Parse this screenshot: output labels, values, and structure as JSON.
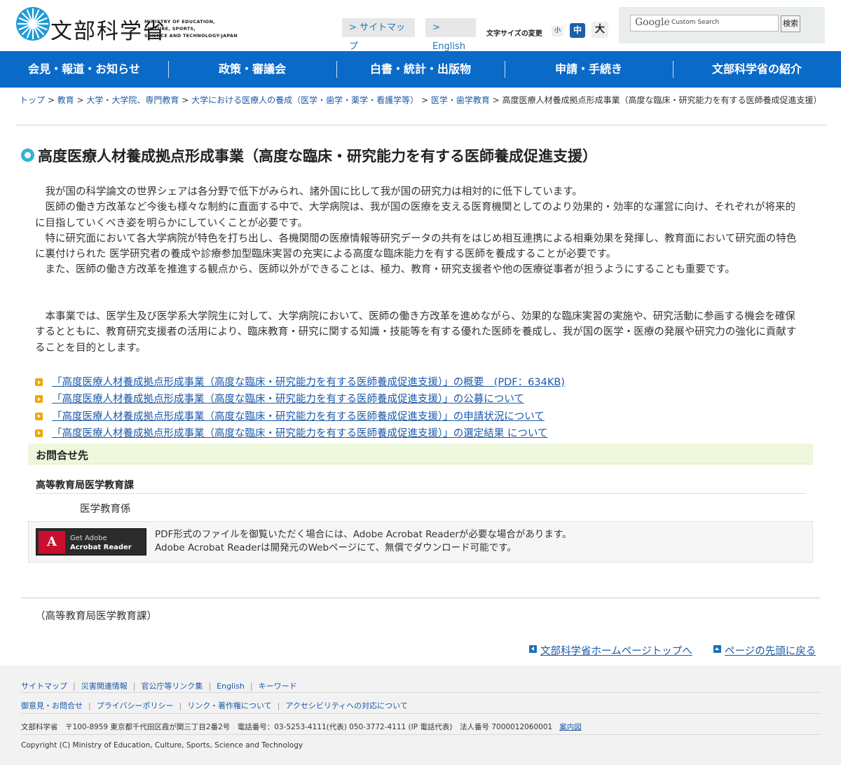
{
  "header": {
    "logo_jp": "文部科学省",
    "logo_en_lines": [
      "MINISTRY OF EDUCATION,",
      "CULTURE, SPORTS,",
      "SCIENCE AND TECHNOLOGY-JAPAN"
    ],
    "sitemap_label": "> サイトマップ",
    "english_label": "> English",
    "fontsize_label": "文字サイズの変更",
    "fontsize_small": "小",
    "fontsize_mid": "中",
    "fontsize_large": "大",
    "search_logo": "Google",
    "search_custom": "Custom Search",
    "search_button": "検索"
  },
  "nav": {
    "items": [
      "会見・報道・お知らせ",
      "政策・審議会",
      "白書・統計・出版物",
      "申請・手続き",
      "文部科学省の紹介"
    ]
  },
  "breadcrumb": {
    "links": [
      "トップ",
      "教育",
      "大学・大学院、専門教育",
      "大学における医療人の養成（医学・歯学・薬学・看護学等）",
      "医学・歯学教育"
    ],
    "separator": " > ",
    "current": "高度医療人材養成拠点形成事業（高度な臨床・研究能力を有する医師養成促進支援）"
  },
  "main": {
    "title": "高度医療人材養成拠点形成事業（高度な臨床・研究能力を有する医師養成促進支援）",
    "para1": [
      "我が国の科学論文の世界シェアは各分野で低下がみられ、諸外国に比して我が国の研究力は相対的に低下しています。",
      "医師の働き方改革など今後も様々な制約に直面する中で、大学病院は、我が国の医療を支える医育機関としてのより効果的・効率的な運営に向け、それぞれが将来的に目指していくべき姿を明らかにしていくことが必要です。",
      "特に研究面において各大学病院が特色を打ち出し、各機関間の医療情報等研究データの共有をはじめ相互連携による相乗効果を発揮し、教育面において研究面の特色に裏付けられた 医学研究者の養成や診療参加型臨床実習の充実による高度な臨床能力を有する医師を養成することが必要です。",
      "また、医師の働き方改革を推進する観点から、医師以外ができることは、極力、教育・研究支援者や他の医療従事者が担うようにすることも重要です。"
    ],
    "para2": "本事業では、医学生及び医学系大学院生に対して、大学病院において、医師の働き方改革を進めながら、効果的な臨床実習の実施や、研究活動に参画する機会を確保するとともに、教育研究支援者の活用により、臨床教育・研究に関する知識・技能等を有する優れた医師を養成し、我が国の医学・医療の発展や研究力の強化に貢献することを目的とします。",
    "links": [
      "「高度医療人材養成拠点形成事業（高度な臨床・研究能力を有する医師養成促進支援）」の概要　(PDF：634KB)",
      "「高度医療人材養成拠点形成事業（高度な臨床・研究能力を有する医師養成促進支援）」の公募について",
      "「高度医療人材養成拠点形成事業（高度な臨床・研究能力を有する医師養成促進支援）」の申請状況について",
      "「高度医療人材養成拠点形成事業（高度な臨床・研究能力を有する医師養成促進支援）」の選定結果 について"
    ],
    "contact_heading": "お問合せ先",
    "department": "高等教育局医学教育課",
    "section": "医学教育係",
    "acrobat_badge_1": "Get Adobe",
    "acrobat_badge_2": "Acrobat Reader",
    "acrobat_line1": "PDF形式のファイルを御覧いただく場合には、Adobe Acrobat Readerが必要な場合があります。",
    "acrobat_line2": "Adobe Acrobat Readerは開発元のWebページにて、無償でダウンロード可能です。",
    "bureau_note": "（高等教育局医学教育課）",
    "home_link": "文部科学省ホームページトップへ",
    "pagetop_link": "ページの先頭に戻る"
  },
  "footer": {
    "row1": [
      "サイトマップ",
      "災害関連情報",
      "官公庁等リンク集",
      "English",
      "キーワード"
    ],
    "row2": [
      "御意見・お問合せ",
      "プライバシーポリシー",
      "リンク・著作権について",
      "アクセシビリティへの対応について"
    ],
    "address": "文部科学省　〒100-8959 東京都千代田区霞が関三丁目2番2号　電話番号：03-5253-4111(代表) 050-3772-4111 (IP 電話代表)　法人番号 7000012060001",
    "map_link": "案内図",
    "copyright": "Copyright (C) Ministry of Education, Culture, Sports, Science and Technology"
  },
  "colors": {
    "nav": "#0a6ac8",
    "link": "#1d5aa8",
    "title_bullet": "#34b1d7",
    "contact_bg": "#eef8dc"
  },
  "icons": [
    "logo-emblem-icon",
    "link-arrow-icon",
    "adobe-acrobat-icon",
    "back-arrow-icon",
    "up-arrow-icon"
  ]
}
